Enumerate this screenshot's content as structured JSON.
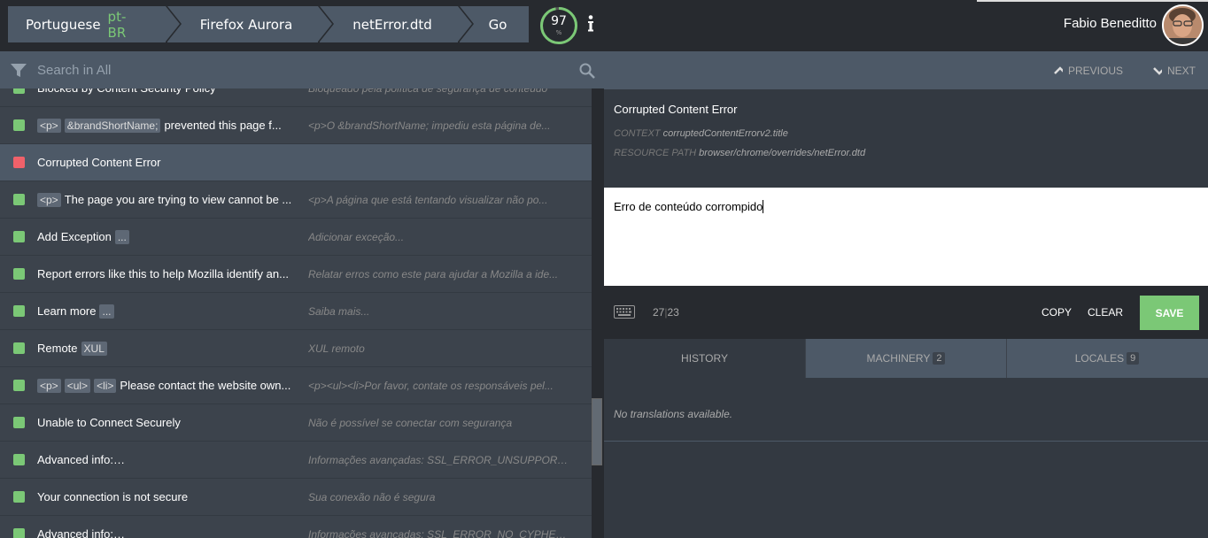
{
  "breadcrumbs": {
    "locale_name": "Portuguese",
    "locale_code": "pt-BR",
    "project": "Firefox Aurora",
    "resource": "netError.dtd",
    "go": "Go"
  },
  "progress": {
    "percent": "97",
    "unit": "%"
  },
  "user": {
    "name": "Fabio Beneditto"
  },
  "search": {
    "placeholder": "Search in All"
  },
  "entities": [
    {
      "status": "translated",
      "source": "Blocked by Content Security Policy",
      "placeholders": [],
      "translation": "Bloqueado pela política de segurança de conteúdo"
    },
    {
      "status": "translated",
      "placeholders": [
        "<p>",
        "&brandShortName;"
      ],
      "source": "prevented this page f...",
      "translation": "<p>O &brandShortName; impediu esta página de..."
    },
    {
      "status": "missing",
      "placeholders": [],
      "source": "Corrupted Content Error",
      "translation": ""
    },
    {
      "status": "translated",
      "placeholders": [
        "<p>"
      ],
      "source": "The page you are trying to view cannot be ...",
      "translation": "<p>A página que está tentando visualizar não po..."
    },
    {
      "status": "translated",
      "placeholders": [],
      "source": "Add Exception",
      "suffix": "...",
      "translation": "Adicionar exceção..."
    },
    {
      "status": "translated",
      "placeholders": [],
      "source": "Report errors like this to help Mozilla identify an...",
      "translation": "Relatar erros como este para ajudar a Mozilla a ide..."
    },
    {
      "status": "translated",
      "placeholders": [],
      "source": "Learn more",
      "suffix": "...",
      "translation": "Saiba mais..."
    },
    {
      "status": "translated",
      "placeholders": [],
      "source": "Remote",
      "suffix": "XUL",
      "translation": "XUL remoto"
    },
    {
      "status": "translated",
      "placeholders": [
        "<p>",
        "<ul>",
        "<li>"
      ],
      "source": "Please contact the website own...",
      "translation": "<p><ul><li>Por favor, contate os responsáveis pel..."
    },
    {
      "status": "translated",
      "placeholders": [],
      "source": "Unable to Connect Securely",
      "translation": "Não é possível se conectar com segurança"
    },
    {
      "status": "translated",
      "placeholders": [],
      "source": "Advanced info:",
      "suffix": "SSL_ERROR_UNSUPPORTED_VE...",
      "translation": "Informações avançadas: SSL_ERROR_UNSUPPORT..."
    },
    {
      "status": "translated",
      "placeholders": [],
      "source": "Your connection is not secure",
      "translation": "Sua conexão não é segura"
    },
    {
      "status": "translated",
      "placeholders": [],
      "source": "Advanced info:",
      "suffix": "SSL_ERROR_NO_CYPHER_OVER...",
      "translation": "Informações avançadas: SSL_ERROR_NO_CYPHER_..."
    }
  ],
  "nav": {
    "previous": "PREVIOUS",
    "next": "NEXT"
  },
  "entity": {
    "title": "Corrupted Content Error",
    "context_label": "CONTEXT",
    "context_value": "corruptedContentErrorv2.title",
    "resource_label": "RESOURCE PATH",
    "resource_value": "browser/chrome/overrides/netError.dtd"
  },
  "editor": {
    "value": "Erro de conteúdo corrompido"
  },
  "toolbar": {
    "count_translation": "27",
    "count_source": "23",
    "copy": "COPY",
    "clear": "CLEAR",
    "save": "SAVE"
  },
  "tabs": {
    "history": "HISTORY",
    "machinery": "MACHINERY",
    "machinery_count": "2",
    "locales": "LOCALES",
    "locales_count": "9"
  },
  "history": {
    "empty": "No translations available."
  },
  "colors": {
    "accent_green": "#7bc876",
    "missing_red": "#f0616a",
    "bar": "#4d5967"
  }
}
